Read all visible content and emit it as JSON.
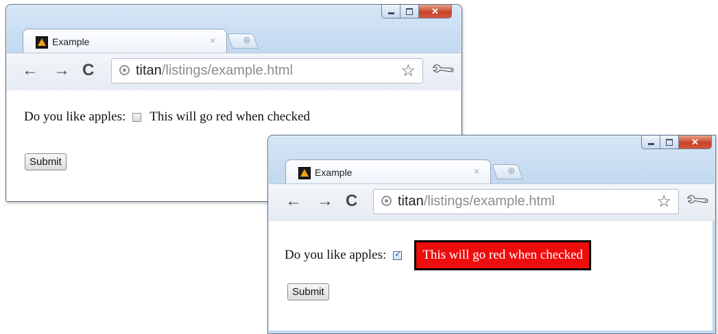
{
  "windows": [
    {
      "tab": {
        "title": "Example",
        "close_glyph": "×"
      },
      "address": {
        "host": "titan",
        "path": "/listings/example.html"
      },
      "page": {
        "question": "Do you like apples:",
        "checkbox_checked": false,
        "note": "This will go red when checked",
        "submit_label": "Submit"
      }
    },
    {
      "tab": {
        "title": "Example",
        "close_glyph": "×"
      },
      "address": {
        "host": "titan",
        "path": "/listings/example.html"
      },
      "page": {
        "question": "Do you like apples:",
        "checkbox_checked": true,
        "note": "This will go red when checked",
        "submit_label": "Submit"
      }
    }
  ],
  "icons": {
    "back": "back-arrow-icon",
    "forward": "forward-arrow-icon",
    "reload": "reload-icon",
    "site": "globe-icon",
    "bookmark": "star-icon",
    "menu": "wrench-icon",
    "favicon": "favicon-icon"
  },
  "colors": {
    "highlight_bg": "#ee0d0d",
    "highlight_text": "#ffffff",
    "highlight_border": "#000000",
    "close_button": "#c7432b"
  }
}
